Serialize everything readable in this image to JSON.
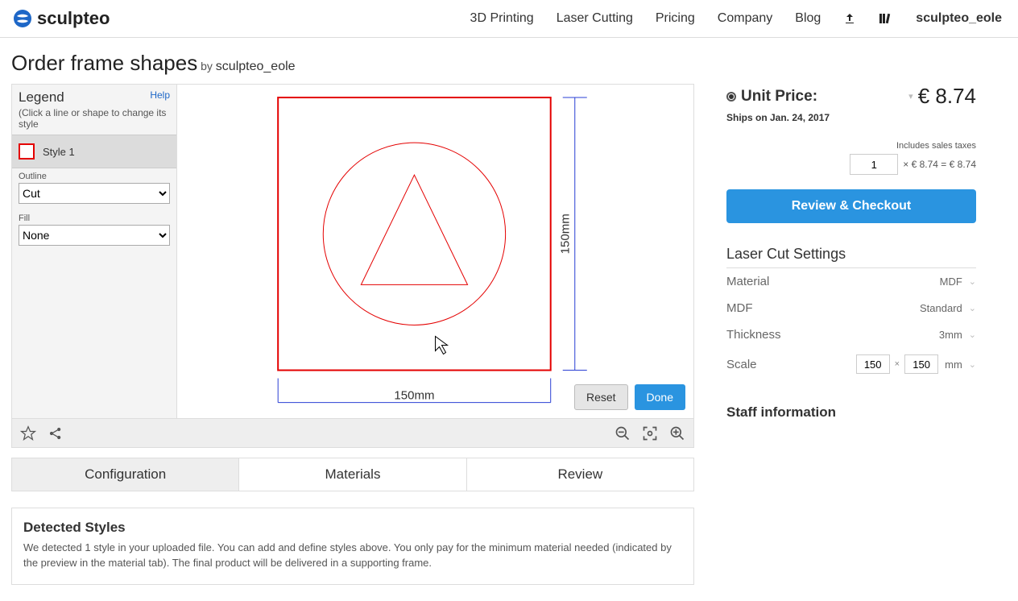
{
  "header": {
    "brand": "sculpteo",
    "nav": [
      "3D Printing",
      "Laser Cutting",
      "Pricing",
      "Company",
      "Blog"
    ],
    "user": "sculpteo_eole"
  },
  "page": {
    "title": "Order frame shapes",
    "by": "by",
    "author": "sculpteo_eole"
  },
  "legend": {
    "title": "Legend",
    "help": "Help",
    "hint": "(Click a line or shape to change its style",
    "style_name": "Style 1",
    "outline_label": "Outline",
    "outline_value": "Cut",
    "fill_label": "Fill",
    "fill_value": "None"
  },
  "canvas": {
    "width_label": "150mm",
    "height_label": "150mm",
    "reset": "Reset",
    "done": "Done"
  },
  "tabs": {
    "configuration": "Configuration",
    "materials": "Materials",
    "review": "Review"
  },
  "detected": {
    "title": "Detected Styles",
    "text": "We detected 1 style in your uploaded file. You can add and define styles above. You only pay for the minimum material needed (indicated by the preview in the material tab). The final product will be delivered in a supporting frame."
  },
  "price": {
    "label": "Unit Price:",
    "value": "€ 8.74",
    "ships": "Ships on Jan. 24, 2017",
    "tax_note": "Includes sales taxes",
    "qty": "1",
    "calc": "× € 8.74 = € 8.74",
    "checkout": "Review & Checkout"
  },
  "settings": {
    "title": "Laser Cut Settings",
    "material_label": "Material",
    "material_value": "MDF",
    "mdf_label": "MDF",
    "mdf_value": "Standard",
    "thickness_label": "Thickness",
    "thickness_value": "3mm",
    "scale_label": "Scale",
    "scale_w": "150",
    "scale_h": "150",
    "scale_unit": "mm"
  },
  "staff": {
    "title": "Staff information"
  }
}
